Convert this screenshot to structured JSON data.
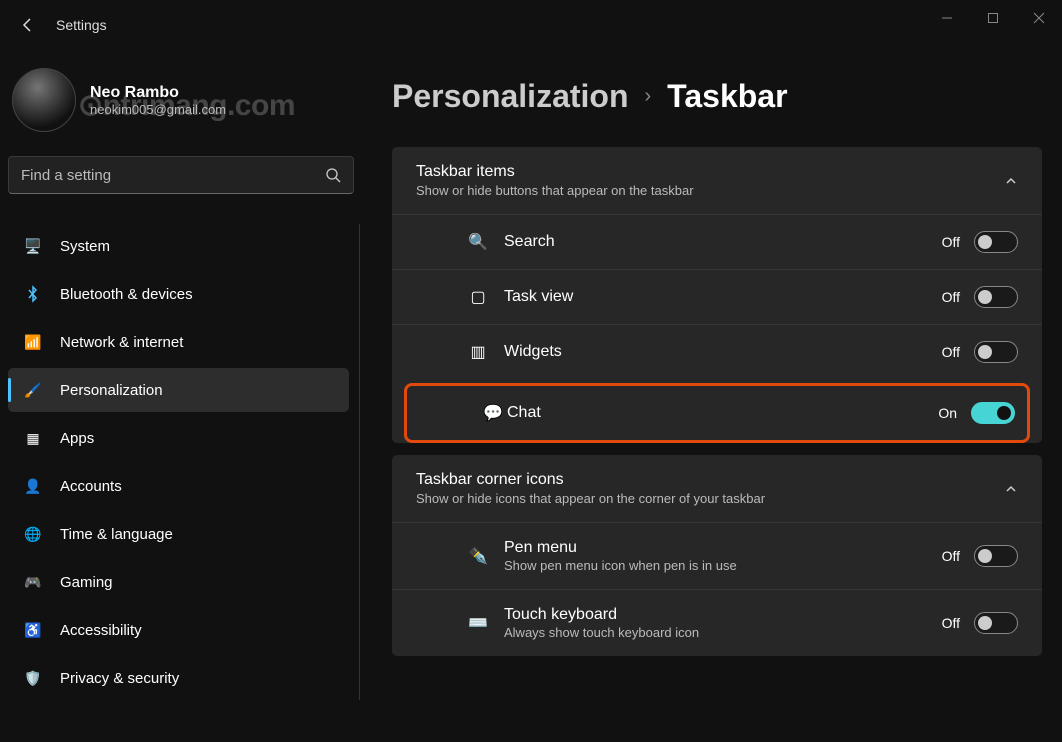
{
  "app": {
    "title": "Settings"
  },
  "profile": {
    "name": "Neo Rambo",
    "email": "neokim005@gmail.com",
    "watermark": "⊙ntrimang.com"
  },
  "search": {
    "placeholder": "Find a setting"
  },
  "nav": [
    {
      "icon": "🖥️",
      "label": "System"
    },
    {
      "icon": "BT",
      "label": "Bluetooth & devices"
    },
    {
      "icon": "📶",
      "label": "Network & internet"
    },
    {
      "icon": "🖌️",
      "label": "Personalization",
      "active": true
    },
    {
      "icon": "▦",
      "label": "Apps"
    },
    {
      "icon": "👤",
      "label": "Accounts"
    },
    {
      "icon": "🌐",
      "label": "Time & language"
    },
    {
      "icon": "🎮",
      "label": "Gaming"
    },
    {
      "icon": "♿",
      "label": "Accessibility"
    },
    {
      "icon": "🛡️",
      "label": "Privacy & security"
    }
  ],
  "breadcrumb": {
    "parent": "Personalization",
    "current": "Taskbar"
  },
  "sections": [
    {
      "title": "Taskbar items",
      "subtitle": "Show or hide buttons that appear on the taskbar",
      "rows": [
        {
          "icon": "🔍",
          "label": "Search",
          "state": "Off",
          "on": false
        },
        {
          "icon": "▢",
          "label": "Task view",
          "state": "Off",
          "on": false
        },
        {
          "icon": "▥",
          "label": "Widgets",
          "state": "Off",
          "on": false
        },
        {
          "icon": "💬",
          "label": "Chat",
          "state": "On",
          "on": true,
          "highlight": true
        }
      ]
    },
    {
      "title": "Taskbar corner icons",
      "subtitle": "Show or hide icons that appear on the corner of your taskbar",
      "rows": [
        {
          "icon": "✒️",
          "label": "Pen menu",
          "sublabel": "Show pen menu icon when pen is in use",
          "state": "Off",
          "on": false
        },
        {
          "icon": "⌨️",
          "label": "Touch keyboard",
          "sublabel": "Always show touch keyboard icon",
          "state": "Off",
          "on": false
        }
      ]
    }
  ]
}
